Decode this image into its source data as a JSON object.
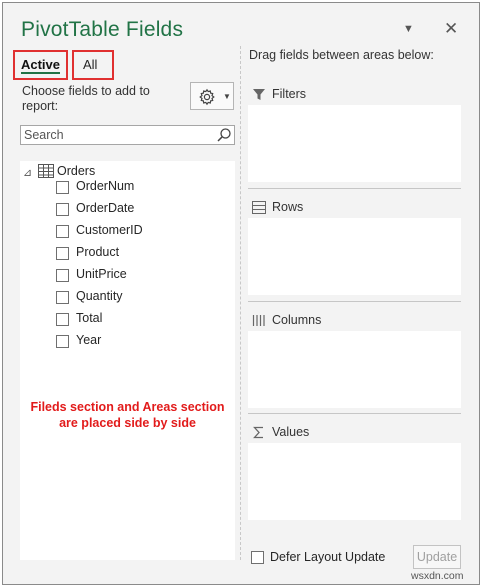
{
  "header": {
    "title": "PivotTable Fields"
  },
  "tabs": [
    {
      "label": "Active"
    },
    {
      "label": "All"
    }
  ],
  "fields_panel": {
    "choose_label": "Choose fields to add to report:",
    "search_placeholder": "Search",
    "table_name": "Orders",
    "fields": [
      {
        "label": "OrderNum"
      },
      {
        "label": "OrderDate"
      },
      {
        "label": "CustomerID"
      },
      {
        "label": "Product"
      },
      {
        "label": "UnitPrice"
      },
      {
        "label": "Quantity"
      },
      {
        "label": "Total"
      },
      {
        "label": "Year"
      }
    ],
    "annotation": "Fileds section and Areas section are placed side by side"
  },
  "areas_panel": {
    "hint": "Drag fields between areas below:",
    "areas": [
      {
        "label": "Filters",
        "icon": "filter-icon"
      },
      {
        "label": "Rows",
        "icon": "rows-icon"
      },
      {
        "label": "Columns",
        "icon": "columns-icon"
      },
      {
        "label": "Values",
        "icon": "sigma-icon"
      }
    ]
  },
  "footer": {
    "defer_label": "Defer Layout Update",
    "update_label": "Update"
  },
  "watermark": "wsxdn.com",
  "colors": {
    "title": "#217346",
    "annotation": "#e21b1b",
    "highlight_border": "#e03030"
  }
}
